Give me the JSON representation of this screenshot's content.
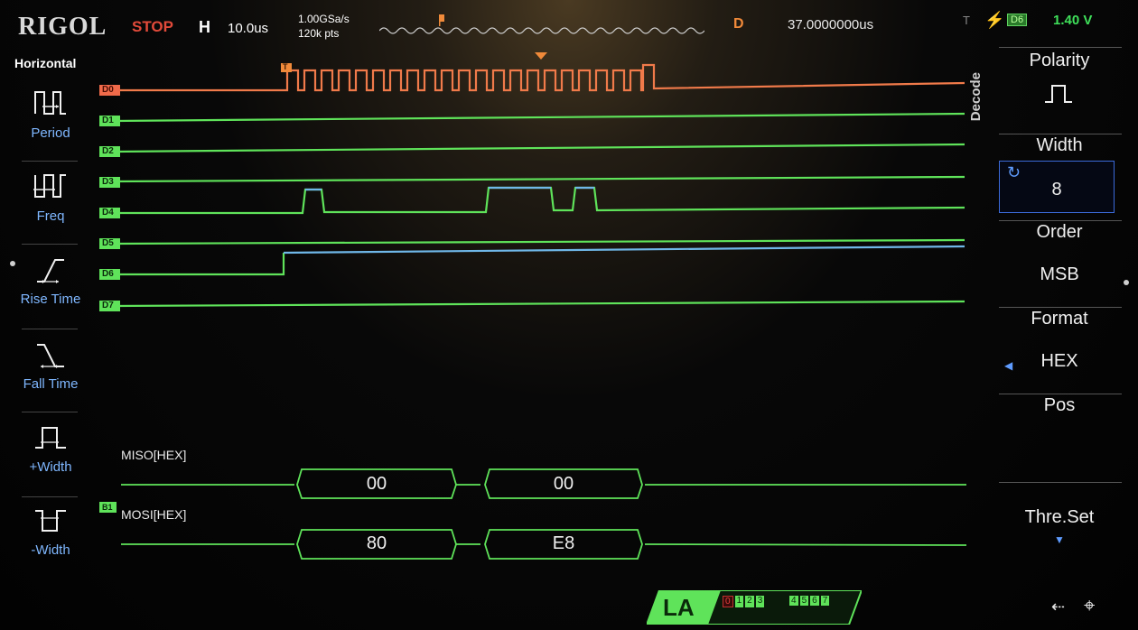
{
  "topbar": {
    "brand": "RIGOL",
    "run_state": "STOP",
    "horizontal_label": "H",
    "timebase": "10.0us",
    "sample_rate": "1.00GSa/s",
    "memory_depth": "120k pts",
    "delay_label": "D",
    "delay_value": "37.0000000us",
    "trigger_label": "T",
    "trigger_source": "D6",
    "trigger_level": "1.40 V",
    "colors": {
      "run_state": "#e24a3a",
      "delay": "#f08a3a",
      "trigger": "#3fe05a"
    }
  },
  "left_panel": {
    "title": "Horizontal",
    "items": [
      {
        "label": "Period",
        "icon": "period-icon"
      },
      {
        "label": "Freq",
        "icon": "freq-icon"
      },
      {
        "label": "Rise Time",
        "icon": "rise-time-icon"
      },
      {
        "label": "Fall Time",
        "icon": "fall-time-icon"
      },
      {
        "label": "+Width",
        "icon": "positive-width-icon"
      },
      {
        "label": "-Width",
        "icon": "negative-width-icon"
      }
    ]
  },
  "right_panel": {
    "side_label": "Decode",
    "polarity": {
      "label": "Polarity",
      "icon": "positive-pulse-icon"
    },
    "width": {
      "label": "Width",
      "value": "8"
    },
    "order": {
      "label": "Order",
      "value": "MSB"
    },
    "format": {
      "label": "Format",
      "value": "HEX"
    },
    "pos": {
      "label": "Pos"
    },
    "thre_set": {
      "label": "Thre.Set"
    }
  },
  "channels": {
    "labels": [
      "D0",
      "D1",
      "D2",
      "D3",
      "D4",
      "D5",
      "D6",
      "D7"
    ],
    "colors": {
      "d0": "#f07a4a",
      "digital": "#5fe35a",
      "high": "#6fb7e8"
    },
    "trigger_marker": "T",
    "bus_marker": "B1"
  },
  "decode": {
    "miso": {
      "name": "MISO[HEX]",
      "values": [
        "00",
        "00"
      ]
    },
    "mosi": {
      "name": "MOSI[HEX]",
      "values": [
        "80",
        "E8"
      ]
    }
  },
  "footer": {
    "la_label": "LA",
    "la_groups_a": [
      "0",
      "1",
      "2",
      "3"
    ],
    "la_groups_b": [
      "4",
      "5",
      "6",
      "7"
    ],
    "usb_icon": "usb-icon",
    "network_icon": "network-icon"
  }
}
